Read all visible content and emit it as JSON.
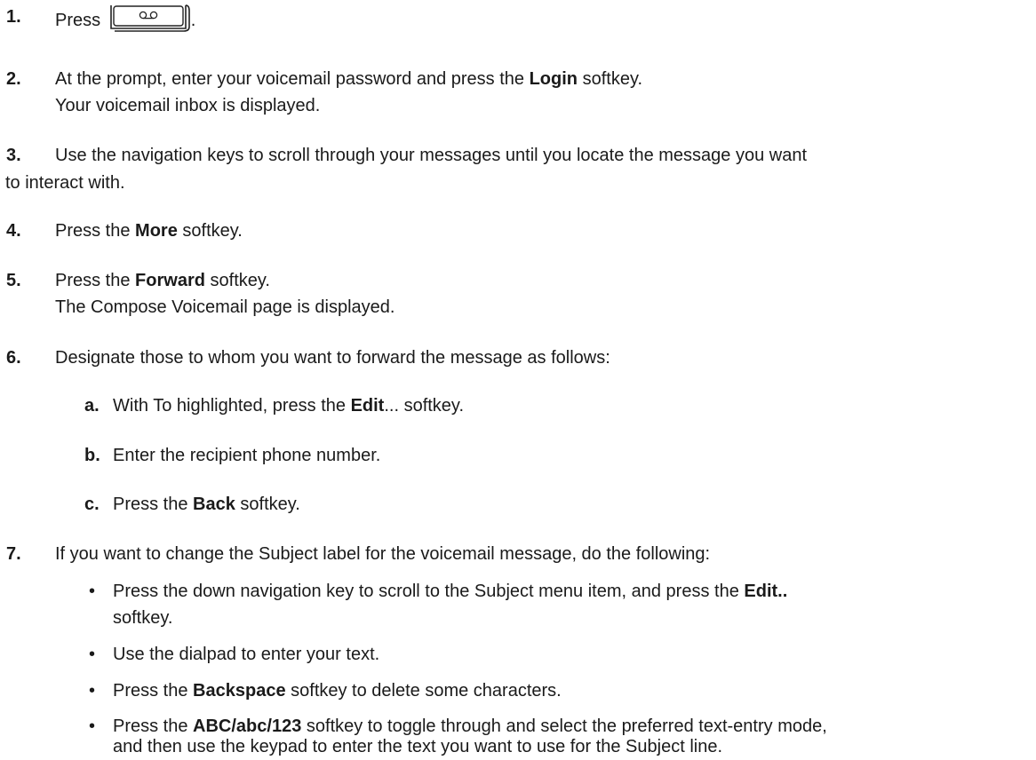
{
  "steps": [
    {
      "num": "1.",
      "pre": "Press ",
      "post": "."
    },
    {
      "num": "2.",
      "t1": "At the prompt, enter your voicemail password and press the ",
      "b1": "Login",
      "t2": " softkey.",
      "line2": "Your voicemail inbox is displayed."
    },
    {
      "num": "3.",
      "line1": "Use the navigation keys to scroll through your messages until you locate the message you want",
      "line2": "to interact with."
    },
    {
      "num": "4.",
      "t1": "Press the ",
      "b1": "More",
      "t2": " softkey."
    },
    {
      "num": "5.",
      "t1": "Press the ",
      "b1": "Forward",
      "t2": " softkey.",
      "line2": "The Compose Voicemail page is displayed."
    },
    {
      "num": "6.",
      "line1": "Designate those to whom you want to forward the message as follows:"
    },
    {
      "num": "7.",
      "line1": "If you want to change the Subject label for the voicemail message, do the following:"
    }
  ],
  "substeps": [
    {
      "label": "a.",
      "t1": "With To highlighted, press the ",
      "b1": "Edit",
      "t2": "... softkey."
    },
    {
      "label": "b.",
      "t1": "Enter the recipient phone number."
    },
    {
      "label": "c.",
      "t1": "Press the ",
      "b1": "Back",
      "t2": " softkey."
    }
  ],
  "bullets": [
    {
      "t1": "Press the down navigation key to scroll to the Subject menu item, and press the ",
      "b1": "Edit..",
      "line2": "softkey."
    },
    {
      "t1": "Use the dialpad to enter your text."
    },
    {
      "t1": "Press the ",
      "b1": "Backspace",
      "t2": " softkey to delete some characters."
    },
    {
      "t1": "Press the ",
      "b1": "ABC/abc/123",
      "t2": " softkey to toggle through and select the preferred text-entry mode,",
      "line2": "and then use the keypad to enter the text you want to use for the Subject line."
    }
  ],
  "bullet_char": "•",
  "icons": {
    "voicemail_key": "voicemail-icon"
  }
}
